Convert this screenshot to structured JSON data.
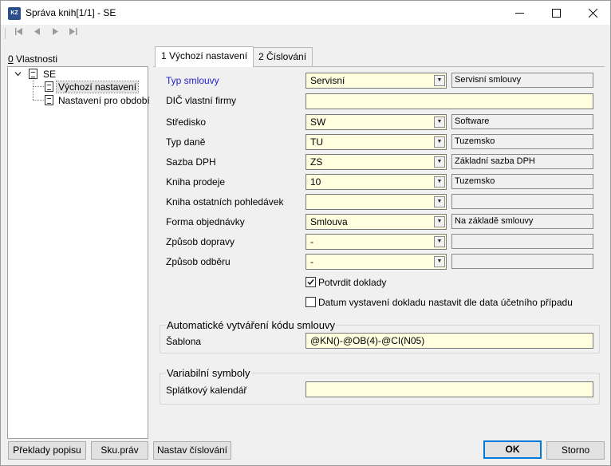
{
  "window": {
    "title": "Správa knih[1/1] - SE",
    "app_icon_text": "KZ",
    "minimize_icon": "minimize-icon",
    "maximize_icon": "maximize-icon",
    "close_icon": "close-icon"
  },
  "toolbar": {
    "icons": [
      "first-record-icon",
      "previous-record-icon",
      "next-record-icon",
      "last-record-icon"
    ]
  },
  "left_panel": {
    "label_hotkey": "0",
    "label_rest": " Vlastnosti",
    "tree": {
      "root": "SE",
      "children": [
        "Výchozí nastavení",
        "Nastavení pro období"
      ],
      "selected_index": 0
    }
  },
  "tabs": [
    {
      "label": "1 Výchozí nastavení",
      "active": true
    },
    {
      "label": "2 Číslování",
      "active": false
    }
  ],
  "form": {
    "typ_smlouvy": {
      "label": "Typ smlouvy",
      "value": "Servisní",
      "description": "Servisní smlouvy"
    },
    "dic": {
      "label": "DIČ vlastní firmy",
      "value": ""
    },
    "stredisko": {
      "label": "Středisko",
      "value": "SW",
      "description": "Software"
    },
    "typ_dane": {
      "label": "Typ daně",
      "value": "TU",
      "description": "Tuzemsko"
    },
    "sazba_dph": {
      "label": "Sazba DPH",
      "value": "ZS",
      "description": "Základní sazba DPH"
    },
    "kniha_prodeje": {
      "label": "Kniha prodeje",
      "value": "10",
      "description": "Tuzemsko"
    },
    "kniha_ostatnich": {
      "label": "Kniha ostatních pohledávek",
      "value": "",
      "description": ""
    },
    "forma_objednavky": {
      "label": "Forma objednávky",
      "value": "Smlouva",
      "description": "Na základě smlouvy"
    },
    "zpusob_dopravy": {
      "label": "Způsob dopravy",
      "value": "-",
      "description": ""
    },
    "zpusob_odberu": {
      "label": "Způsob odběru",
      "value": "-",
      "description": ""
    },
    "potvrdit_doklady": {
      "label": "Potvrdit doklady",
      "checked": true
    },
    "datum_vystaveni": {
      "label": "Datum vystavení dokladu nastavit dle data účetního případu",
      "checked": false
    }
  },
  "group_auto": {
    "title": "Automatické vytváření kódu smlouvy",
    "sablona_label": "Šablona",
    "sablona_value": "@KN()-@OB(4)-@CI(N05)"
  },
  "group_var": {
    "title": "Variabilní symboly",
    "splatkovy_label": "Splátkový kalendář",
    "splatkovy_value": ""
  },
  "buttons": {
    "preklady": "Překlady popisu",
    "sku_prav": "Sku.práv",
    "nastav_cislovani": "Nastav číslování",
    "ok": "OK",
    "storno": "Storno"
  },
  "colors": {
    "field_background": "#ffffe0",
    "label_accent": "#2323c8",
    "default_button_border": "#0078d7"
  }
}
